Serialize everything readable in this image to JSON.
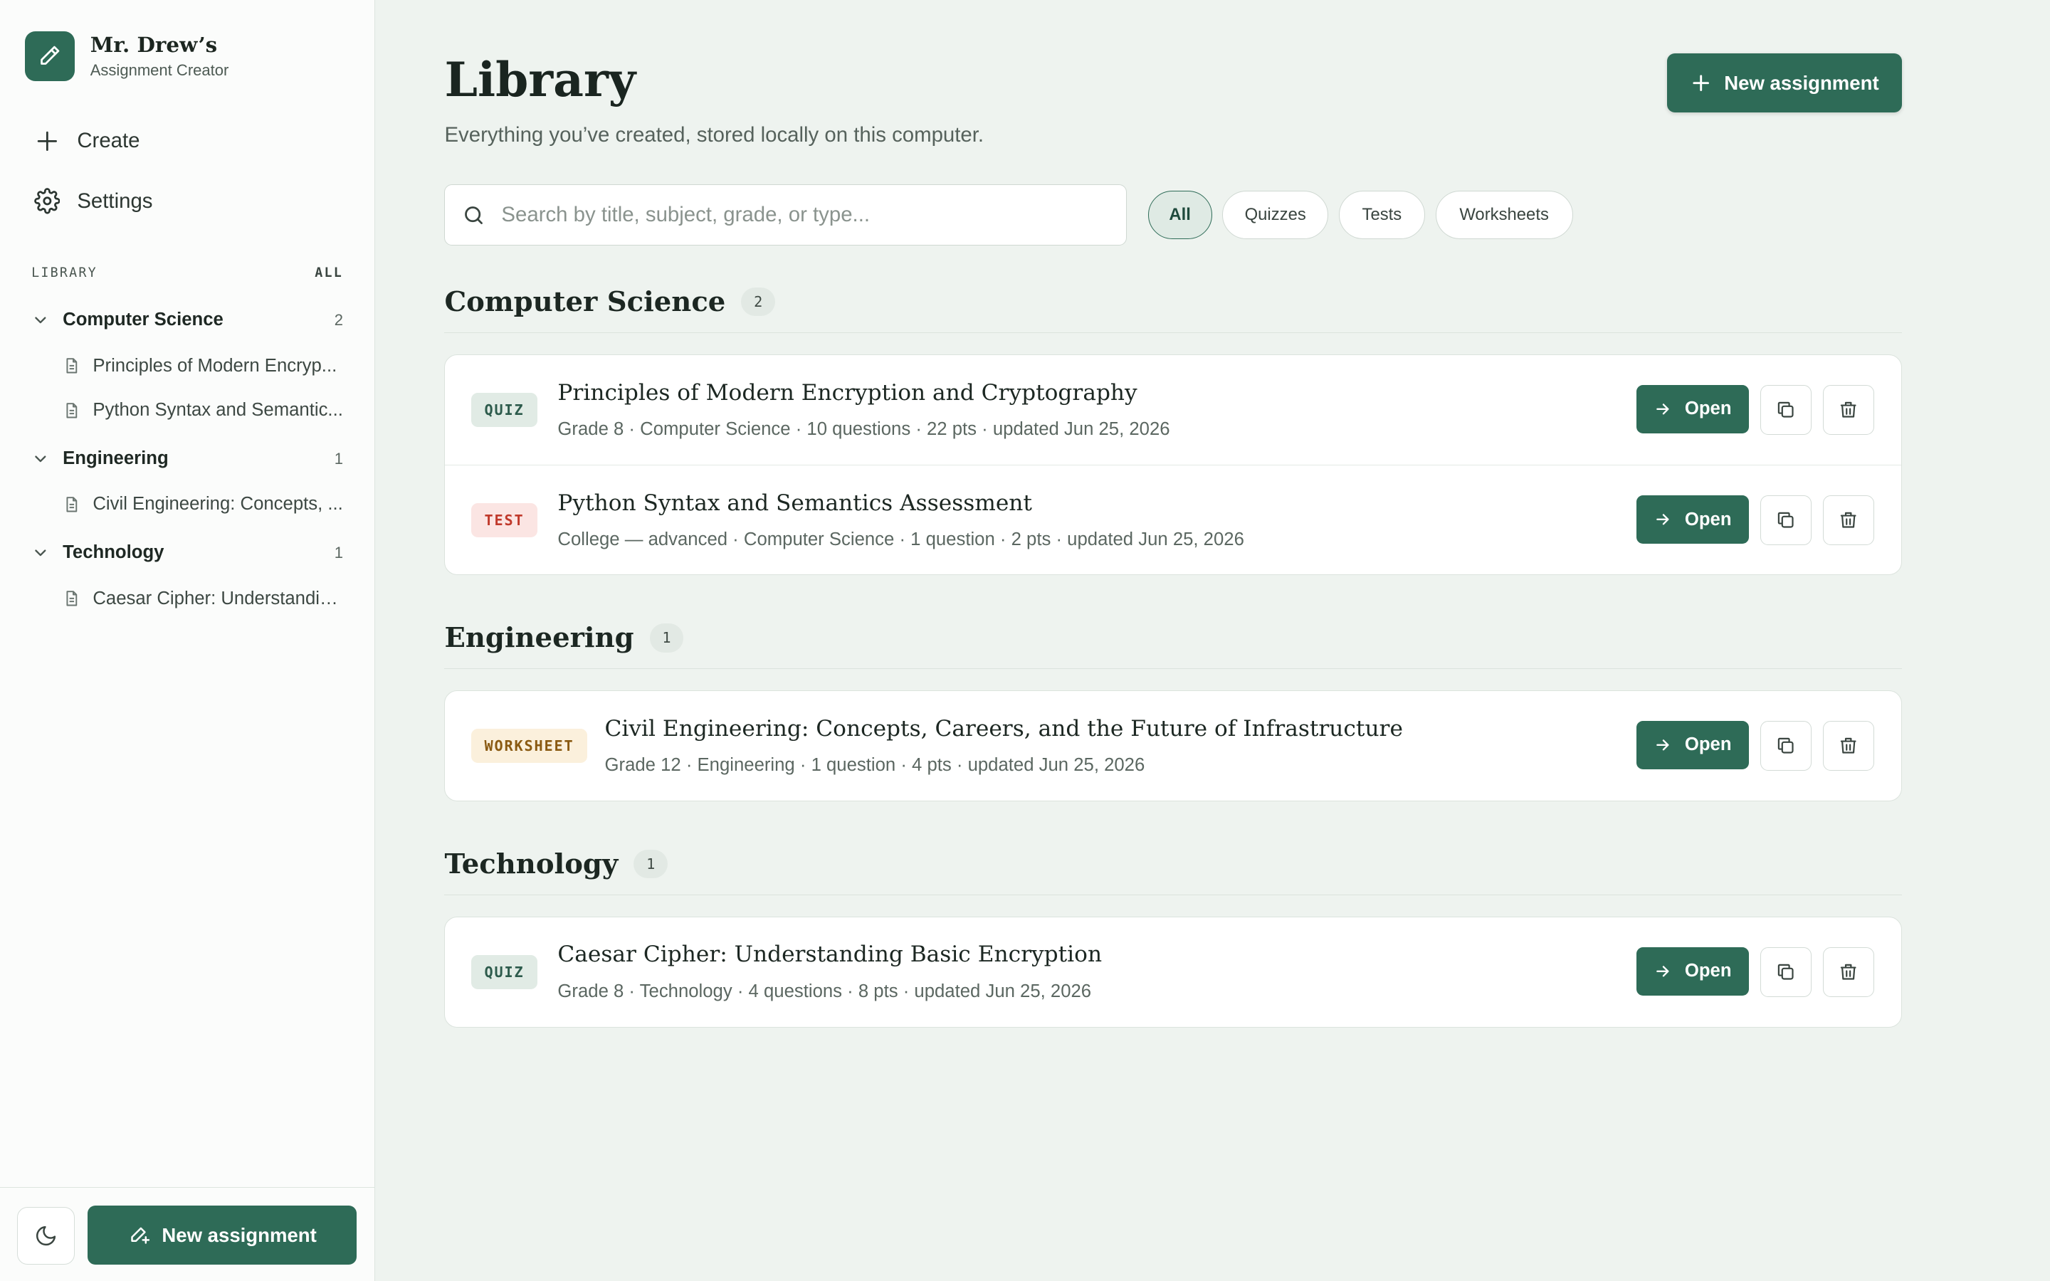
{
  "brand": {
    "title": "Mr. Drew’s",
    "subtitle": "Assignment Creator"
  },
  "nav": {
    "create": "Create",
    "settings": "Settings"
  },
  "library_sidebar": {
    "heading": "LIBRARY",
    "all_label": "ALL",
    "groups": [
      {
        "name": "Computer Science",
        "count": "2",
        "items": [
          "Principles of Modern Encryp...",
          "Python Syntax and Semantic..."
        ]
      },
      {
        "name": "Engineering",
        "count": "1",
        "items": [
          "Civil Engineering: Concepts, ..."
        ]
      },
      {
        "name": "Technology",
        "count": "1",
        "items": [
          "Caesar Cipher: Understandin..."
        ]
      }
    ]
  },
  "sidebar_footer": {
    "new_assignment": "New assignment"
  },
  "header": {
    "title": "Library",
    "subtitle": "Everything you’ve created, stored locally on this computer.",
    "new_assignment": "New assignment"
  },
  "search": {
    "placeholder": "Search by title, subject, grade, or type...",
    "value": ""
  },
  "filters": [
    "All",
    "Quizzes",
    "Tests",
    "Worksheets"
  ],
  "active_filter": "All",
  "open_label": "Open",
  "sections": [
    {
      "title": "Computer Science",
      "count": "2",
      "rows": [
        {
          "type": "QUIZ",
          "title": "Principles of Modern Encryption and Cryptography",
          "meta": "Grade 8 · Computer Science · 10 questions · 22 pts · updated Jun 25, 2026"
        },
        {
          "type": "TEST",
          "title": "Python Syntax and Semantics Assessment",
          "meta": "College — advanced · Computer Science · 1 question · 2 pts · updated Jun 25, 2026"
        }
      ]
    },
    {
      "title": "Engineering",
      "count": "1",
      "rows": [
        {
          "type": "WORKSHEET",
          "title": "Civil Engineering: Concepts, Careers, and the Future of Infrastructure",
          "meta": "Grade 12 · Engineering · 1 question · 4 pts · updated Jun 25, 2026"
        }
      ]
    },
    {
      "title": "Technology",
      "count": "1",
      "rows": [
        {
          "type": "QUIZ",
          "title": "Caesar Cipher: Understanding Basic Encryption",
          "meta": "Grade 8 · Technology · 4 questions · 8 pts · updated Jun 25, 2026"
        }
      ]
    }
  ],
  "colors": {
    "accent": "#2e6b57",
    "background": "#eef3ef",
    "quiz": "#2d5b4c",
    "test": "#c0392b",
    "worksheet": "#8a5a12"
  }
}
